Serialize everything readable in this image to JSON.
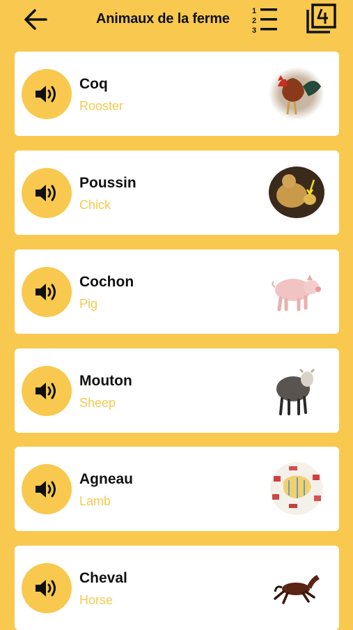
{
  "header": {
    "title": "Animaux de la ferme"
  },
  "colors": {
    "accent": "#F8C94E",
    "card": "#FFFFFF",
    "text": "#111111"
  },
  "icons": [
    "back-arrow-icon",
    "numbered-list-icon",
    "number-four-icon",
    "speaker-icon"
  ],
  "animals": [
    {
      "name": "Coq",
      "translation": "Rooster",
      "image": "rooster-image"
    },
    {
      "name": "Poussin",
      "translation": "Chick",
      "image": "chick-image"
    },
    {
      "name": "Cochon",
      "translation": "Pig",
      "image": "pig-image"
    },
    {
      "name": "Mouton",
      "translation": "Sheep",
      "image": "sheep-image"
    },
    {
      "name": "Agneau",
      "translation": "Lamb",
      "image": "lamb-cuts-image"
    },
    {
      "name": "Cheval",
      "translation": "Horse",
      "image": "horse-image"
    }
  ]
}
